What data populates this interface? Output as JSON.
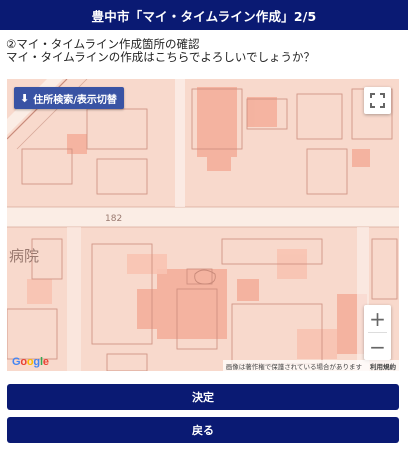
{
  "header": {
    "title": "豊中市「マイ・タイムライン作成」2/5"
  },
  "step": {
    "title": "②マイ・タイムライン作成箇所の確認",
    "question": "マイ・タイムラインの作成はこちらでよろしいでしょうか？"
  },
  "map": {
    "search_button": {
      "icon": "arrow-down-icon",
      "label": "住所検索/表示切替"
    },
    "fullscreen_icon": "fullscreen-icon",
    "zoom_in": "+",
    "zoom_out": "−",
    "logo": "Google",
    "attribution": "画像は著作権で保護されている場合があります",
    "terms_link": "利用規約",
    "labels": {
      "street": "182",
      "building": "病院"
    },
    "colors": {
      "base": "#f6e7df",
      "hazard_light": "#f9cfc0",
      "hazard_dark": "#f4a996",
      "road": "#fbf3ef"
    }
  },
  "buttons": {
    "decide": "決定",
    "back": "戻る"
  },
  "colors": {
    "primary": "#0a1a73",
    "map_button": "#3953a4"
  }
}
